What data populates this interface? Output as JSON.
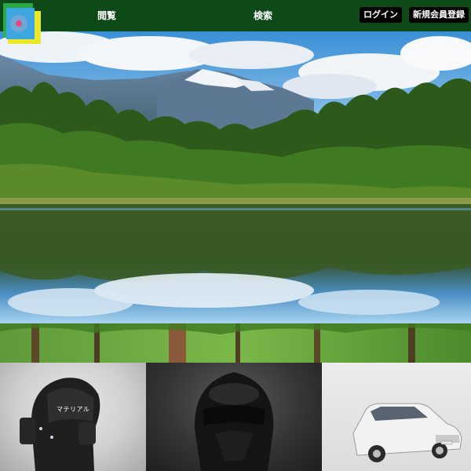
{
  "header": {
    "nav_browse": "閲覧",
    "nav_search": "検索",
    "login_label": "ログイン",
    "register_label": "新規会員登録",
    "bar_color": "#0d4a18"
  },
  "logo": {
    "icon": "logo-icon"
  },
  "hero": {
    "image": "mountain-lake-reflection"
  },
  "strip": {
    "image": "forest-strip"
  },
  "gallery": {
    "items": [
      {
        "image": "black-tactical-helmet",
        "label": "マテリアル"
      },
      {
        "image": "black-trooper-helmet"
      },
      {
        "image": "white-sedan-car"
      }
    ]
  }
}
